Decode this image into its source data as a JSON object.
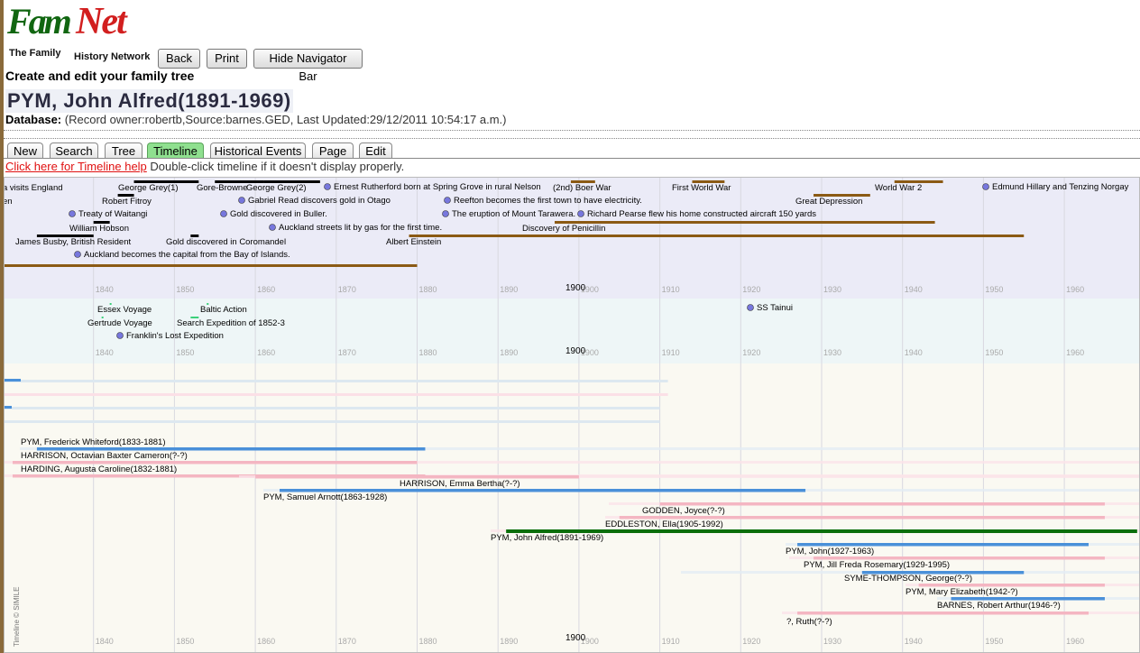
{
  "logo": {
    "fam": "Fam",
    "net": "Net",
    "tag_line1": "The Family",
    "tag_line2": "History Network"
  },
  "toolbar": {
    "back": "Back",
    "print": "Print",
    "hide_nav": "Hide Navigator Bar"
  },
  "subtitle": "Create and edit your family tree",
  "person": {
    "title": "PYM, John Alfred(1891-1969)"
  },
  "database": {
    "label": "Database:",
    "value": "(Record owner:robertb,Source:barnes.GED, Last Updated:29/12/2011 10:54:17 a.m.)"
  },
  "tabs": [
    "New",
    "Search",
    "Tree",
    "Timeline",
    "Historical Events",
    "Page",
    "Edit"
  ],
  "active_tab": "Timeline",
  "help": {
    "link": "Click here for Timeline help",
    "note": "Double-click timeline if it doesn't display properly."
  },
  "timeline": {
    "credit": "Timeline © SIMILE",
    "decade_labels": [
      "1840",
      "1850",
      "1860",
      "1870",
      "1880",
      "1890",
      "1900",
      "1910",
      "1920",
      "1930",
      "1940",
      "1950",
      "1960"
    ],
    "center_label": "1900",
    "band_history": [
      {
        "label": "a visits England",
        "start": 1829,
        "end": null,
        "kind": "text"
      },
      {
        "label": "en",
        "start": 1829,
        "end": null,
        "kind": "text"
      },
      {
        "label": "George Grey(1)",
        "start": 1845,
        "end": 1853,
        "color": "#000000",
        "kind": "dur"
      },
      {
        "label": "Gore-Browne",
        "start": 1855,
        "end": 1861,
        "color": "#000000",
        "kind": "dur"
      },
      {
        "label": "George Grey(2)",
        "start": 1861,
        "end": 1868,
        "color": "#000000",
        "kind": "dur"
      },
      {
        "label": "Robert Fitroy",
        "start": 1843,
        "end": 1845,
        "color": "#000000",
        "kind": "dur"
      },
      {
        "label": "Treaty of Waitangi",
        "start": 1840,
        "end": null,
        "kind": "point"
      },
      {
        "label": "William Hobson",
        "start": 1840,
        "end": 1842,
        "color": "#000000",
        "kind": "dur"
      },
      {
        "label": "James Busby, British Resident",
        "start": 1833,
        "end": 1840,
        "color": "#000000",
        "kind": "dur"
      },
      {
        "label": "Auckland becomes the capital from the Bay of Islands.",
        "start": 1841,
        "end": null,
        "kind": "point"
      },
      {
        "label": "Gold discovered in Coromandel",
        "start": 1852,
        "end": 1853,
        "color": "#000000",
        "kind": "dur"
      },
      {
        "label": "Gabriel Read discovers gold in Otago",
        "start": 1861,
        "end": null,
        "kind": "point"
      },
      {
        "label": "Gold discovered in Buller.",
        "start": 1859,
        "end": null,
        "kind": "point"
      },
      {
        "label": "Auckland streets lit by gas for the first time.",
        "start": 1865,
        "end": null,
        "kind": "point"
      },
      {
        "label": "Ernest Rutherford born at Spring Grove in rural Nelson",
        "start": 1871,
        "end": null,
        "kind": "point"
      },
      {
        "label": "Reefton becomes the first town to have electricity.",
        "start": 1888,
        "end": null,
        "kind": "point"
      },
      {
        "label": "The eruption of Mount Tarawera.",
        "start": 1886,
        "end": null,
        "kind": "point"
      },
      {
        "label": "Richard Pearse flew his home constructed aircraft 150 yards",
        "start": 1903,
        "end": null,
        "kind": "point"
      },
      {
        "label": "(2nd) Boer War",
        "start": 1899,
        "end": 1902,
        "color": "#8b5a14",
        "kind": "dur"
      },
      {
        "label": "First World War",
        "start": 1914,
        "end": 1918,
        "color": "#8b5a14",
        "kind": "dur"
      },
      {
        "label": "Great Depression",
        "start": 1929,
        "end": 1936,
        "color": "#8b5a14",
        "kind": "dur"
      },
      {
        "label": "World War 2",
        "start": 1939,
        "end": 1945,
        "color": "#8b5a14",
        "kind": "dur"
      },
      {
        "label": "Edmund Hillary and Tenzing Norgay",
        "start": 1953,
        "end": null,
        "kind": "point"
      },
      {
        "label": "Discovery of Penicillin",
        "start": 1897,
        "end": 1944,
        "color": "#8b5a14",
        "kind": "dur"
      },
      {
        "label": "Albert Einstein",
        "start": 1879,
        "end": 1955,
        "color": "#8b5a14",
        "kind": "dur"
      },
      {
        "label": "",
        "start": 1829,
        "end": 1880,
        "color": "#8b5a14",
        "kind": "dur"
      }
    ],
    "band_voyages": [
      {
        "label": "Essex Voyage",
        "start": 1842,
        "end": null,
        "kind": "dur"
      },
      {
        "label": "Baltic Action",
        "start": 1854,
        "end": null,
        "kind": "dur"
      },
      {
        "label": "Gertrude Voyage",
        "start": 1841,
        "end": null,
        "kind": "dur"
      },
      {
        "label": "Search Expedition of 1852-3",
        "start": 1852,
        "end": 1853,
        "kind": "dur"
      },
      {
        "label": "Franklin's Lost Expedition",
        "start": 1845,
        "end": null,
        "kind": "point"
      },
      {
        "label": "SS Tainui",
        "start": 1922,
        "end": null,
        "kind": "point"
      }
    ],
    "band_people": [
      {
        "label": "PYM, Frederick Whiteford(1833-1881)",
        "start": 1833,
        "end": 1881,
        "sex": "m"
      },
      {
        "label": "HARRISON, Octavian Baxter Cameron(?-?)",
        "start": 1830,
        "end": 1880,
        "sex": "f"
      },
      {
        "label": "HARDING, Augusta Caroline(1832-1881)",
        "start": 1830,
        "end": 1881,
        "sex": "f"
      },
      {
        "label": "HARRISON, Emma Bertha(?-?)",
        "start": 1860,
        "end": 1900,
        "sex": "f"
      },
      {
        "label": "PYM, Samuel Arnott(1863-1928)",
        "start": 1863,
        "end": 1928,
        "sex": "m"
      },
      {
        "label": "GODDEN, Joyce(?-?)",
        "start": 1910,
        "end": 1965,
        "sex": "f"
      },
      {
        "label": "EDDLESTON, Ella(1905-1992)",
        "start": 1905,
        "end": 1965,
        "sex": "f"
      },
      {
        "label": "PYM, John Alfred(1891-1969)",
        "start": 1891,
        "end": 1969,
        "sex": "self"
      },
      {
        "label": "PYM, John(1927-1963)",
        "start": 1927,
        "end": 1963,
        "sex": "m"
      },
      {
        "label": "PYM, Jill Freda Rosemary(1929-1995)",
        "start": 1929,
        "end": 1965,
        "sex": "f"
      },
      {
        "label": "SYME-THOMPSON, George(?-?)",
        "start": 1935,
        "end": 1955,
        "sex": "m"
      },
      {
        "label": "PYM, Mary Elizabeth(1942-?)",
        "start": 1942,
        "end": 1965,
        "sex": "f"
      },
      {
        "label": "BARNES, Robert Arthur(1946-?)",
        "start": 1946,
        "end": 1965,
        "sex": "m"
      },
      {
        "label": "?, Ruth(?-?)",
        "start": 1927,
        "end": 1963,
        "sex": "f"
      }
    ],
    "colors": {
      "male": "#4a90d9",
      "female": "#f4b6c2",
      "self": "#0a6e0a",
      "point": "#7777dd",
      "band1_bg": "#ebebf7",
      "band2_bg": "#eef6f7",
      "band3_bg": "#faf9f2"
    }
  }
}
